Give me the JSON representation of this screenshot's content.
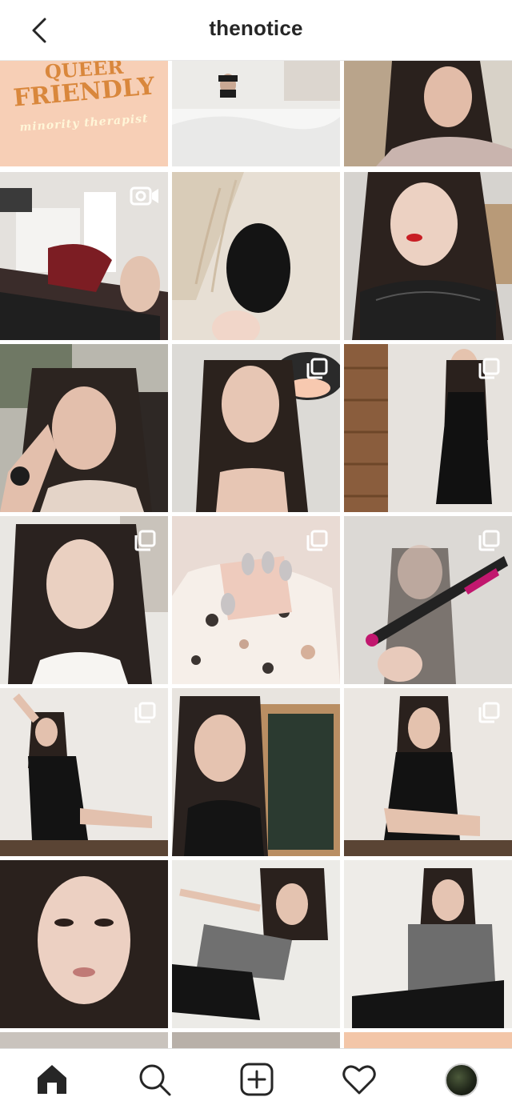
{
  "header": {
    "title": "thenotice",
    "back_icon": "chevron-left-icon"
  },
  "posts": [
    {
      "id": "p1",
      "caption": [
        "QUEER",
        "FRIENDLY",
        "minority therapist"
      ],
      "icon": "none"
    },
    {
      "id": "p2",
      "icon": "none"
    },
    {
      "id": "p3",
      "icon": "none"
    },
    {
      "id": "p4",
      "icon": "video-icon"
    },
    {
      "id": "p5",
      "icon": "none"
    },
    {
      "id": "p6",
      "icon": "none"
    },
    {
      "id": "p7",
      "icon": "none"
    },
    {
      "id": "p8",
      "icon": "multiple-photos-icon"
    },
    {
      "id": "p9",
      "icon": "multiple-photos-icon"
    },
    {
      "id": "p10",
      "icon": "multiple-photos-icon"
    },
    {
      "id": "p11",
      "icon": "multiple-photos-icon"
    },
    {
      "id": "p12",
      "icon": "multiple-photos-icon"
    },
    {
      "id": "p13",
      "icon": "multiple-photos-icon"
    },
    {
      "id": "p14",
      "icon": "none"
    },
    {
      "id": "p15",
      "icon": "multiple-photos-icon"
    },
    {
      "id": "p16",
      "icon": "none"
    },
    {
      "id": "p17",
      "icon": "none"
    },
    {
      "id": "p18",
      "icon": "none"
    }
  ],
  "tabbar": {
    "items": [
      "home-icon",
      "search-icon",
      "new-post-icon",
      "activity-heart-icon",
      "profile-avatar"
    ],
    "active": "home-icon"
  },
  "colors": {
    "text": "#262626",
    "background": "#ffffff",
    "accent_peach": "#f7cfb6",
    "caption_orange": "#d9873c"
  }
}
